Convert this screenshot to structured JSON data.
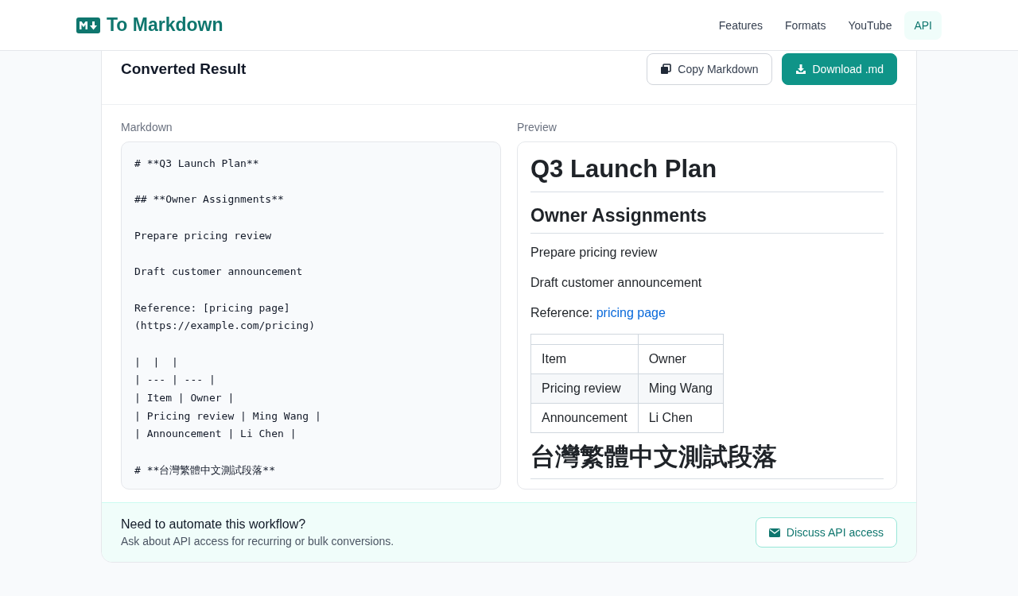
{
  "brand": {
    "name": "To Markdown"
  },
  "nav": [
    {
      "label": "Features",
      "selected": false
    },
    {
      "label": "Formats",
      "selected": false
    },
    {
      "label": "YouTube",
      "selected": false
    },
    {
      "label": "API",
      "selected": true
    }
  ],
  "result": {
    "title": "Converted Result",
    "copy_button": "Copy Markdown",
    "download_button": "Download .md"
  },
  "markdown": {
    "label": "Markdown",
    "blocks": [
      [
        "# **Q3 Launch Plan**"
      ],
      [
        "## **Owner Assignments**"
      ],
      [
        "Prepare pricing review"
      ],
      [
        "Draft customer announcement"
      ],
      [
        "Reference: [pricing page]",
        "(https://example.com/pricing)"
      ],
      [
        "|  |  |",
        "| --- | --- |",
        "| Item | Owner |",
        "| Pricing review | Ming Wang |",
        "| Announcement | Li Chen |"
      ],
      [
        "# **台灣繁體中文測試段落**"
      ]
    ]
  },
  "preview": {
    "label": "Preview",
    "blocks": [
      {
        "kind": "h1",
        "text": "Q3 Launch Plan"
      },
      {
        "kind": "h2",
        "text": "Owner Assignments"
      },
      {
        "kind": "p",
        "text": "Prepare pricing review"
      },
      {
        "kind": "p",
        "text": "Draft customer announcement"
      },
      {
        "kind": "p",
        "text": "Reference:",
        "link": "pricing page"
      },
      {
        "kind": "table",
        "rows": [
          [
            "Item",
            "Owner"
          ],
          [
            "Pricing review",
            "Ming Wang"
          ],
          [
            "Announcement",
            "Li Chen"
          ]
        ]
      },
      {
        "kind": "h1",
        "text": "台灣繁體中文測試段落"
      }
    ]
  },
  "footer": {
    "title": "Need to automate this workflow?",
    "subtitle": "Ask about API access for recurring or bulk conversions.",
    "button": "Discuss API access"
  }
}
